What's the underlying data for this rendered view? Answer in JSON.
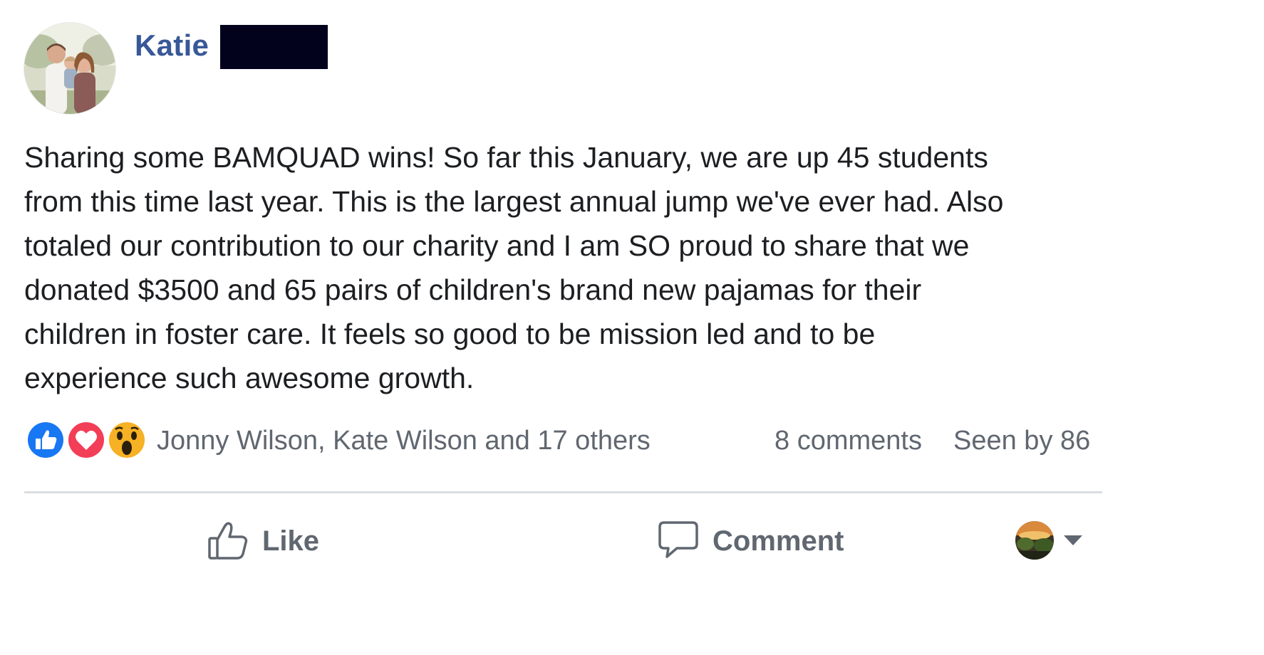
{
  "post": {
    "author_first_name": "Katie",
    "text_lines": [
      "Sharing some BAMQUAD wins! So far this January, we are up 45 students",
      "from this time last year. This is the largest annual jump we've ever had. Also",
      "totaled our contribution to our charity and I am SO proud to share that we",
      "donated $3500 and 65 pairs of children's brand new pajamas for their",
      "children in foster care. It feels so good to be mission led and to be",
      "experience such awesome growth."
    ]
  },
  "reactions": {
    "icons": [
      "like-icon",
      "love-icon",
      "wow-icon"
    ],
    "reactors_text": "Jonny Wilson, Kate Wilson and 17 others",
    "comments_text": "8 comments",
    "seen_text": "Seen by 86"
  },
  "actions": {
    "like_label": "Like",
    "comment_label": "Comment"
  },
  "colors": {
    "author_link": "#385898",
    "meta_text": "#606770",
    "like_blue": "#1877f2",
    "love_red": "#f33e58",
    "wow_yellow": "#f7b125",
    "redaction": "#02021c"
  }
}
